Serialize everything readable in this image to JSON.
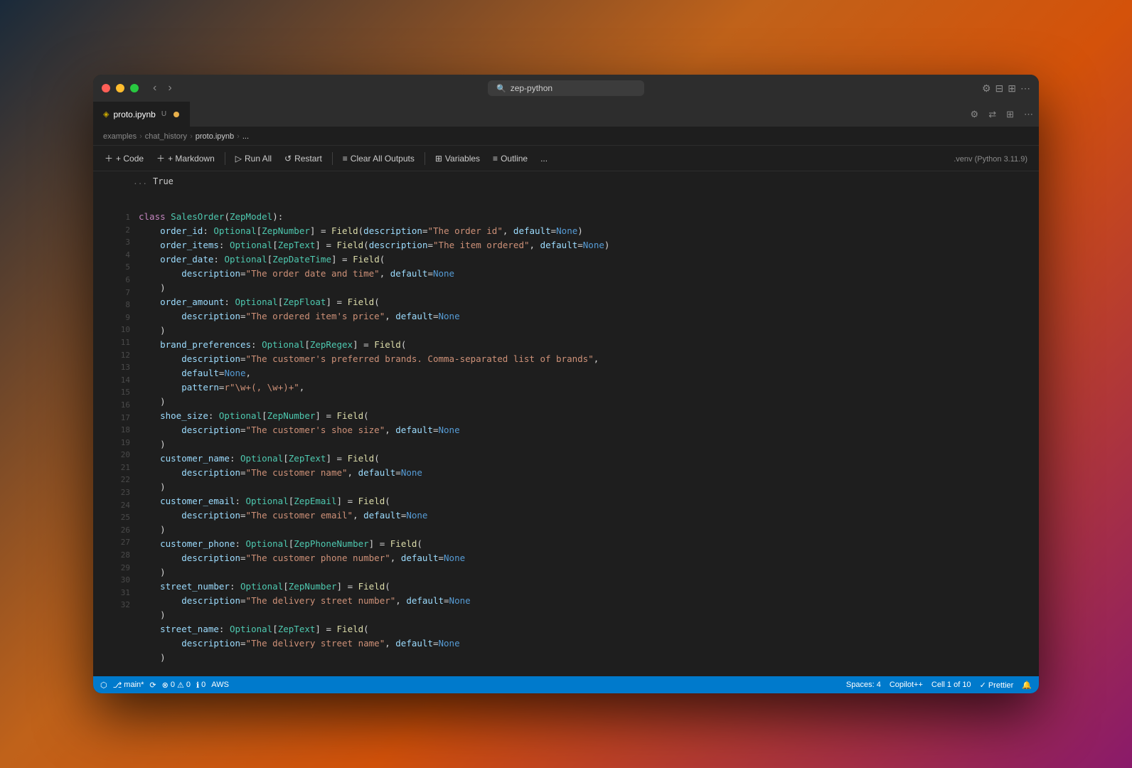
{
  "window": {
    "title": "zep-python"
  },
  "tab": {
    "name": "proto.ipynb",
    "badge": "U",
    "modified": true
  },
  "breadcrumb": {
    "items": [
      "examples",
      "chat_history",
      "proto.ipynb",
      "..."
    ]
  },
  "toolbar": {
    "code_label": "+ Code",
    "markdown_label": "+ Markdown",
    "run_all_label": "Run All",
    "restart_label": "Restart",
    "clear_outputs_label": "Clear All Outputs",
    "variables_label": "Variables",
    "outline_label": "Outline",
    "more_label": "..."
  },
  "output": {
    "prompt": "...",
    "text": "True"
  },
  "code": {
    "lines": [
      "class SalesOrder(ZepModel):",
      "    order_id: Optional[ZepNumber] = Field(description=\"The order id\", default=None)",
      "    order_items: Optional[ZepText] = Field(description=\"The item ordered\", default=None)",
      "    order_date: Optional[ZepDateTime] = Field(",
      "        description=\"The order date and time\", default=None",
      "    )",
      "    order_amount: Optional[ZepFloat] = Field(",
      "        description=\"The ordered item's price\", default=None",
      "    )",
      "    brand_preferences: Optional[ZepRegex] = Field(",
      "        description=\"The customer's preferred brands. Comma-separated list of brands\",",
      "        default=None,",
      "        pattern=r\"\\w+(, \\w+)+\",",
      "    )",
      "    shoe_size: Optional[ZepNumber] = Field(",
      "        description=\"The customer's shoe size\", default=None",
      "    )",
      "    customer_name: Optional[ZepText] = Field(",
      "        description=\"The customer name\", default=None",
      "    )",
      "    customer_email: Optional[ZepEmail] = Field(",
      "        description=\"The customer email\", default=None",
      "    )",
      "    customer_phone: Optional[ZepPhoneNumber] = Field(",
      "        description=\"The customer phone number\", default=None",
      "    )",
      "    street_number: Optional[ZepNumber] = Field(",
      "        description=\"The delivery street number\", default=None",
      "    )",
      "    street_name: Optional[ZepText] = Field(",
      "        description=\"The delivery street name\", default=None",
      "    )"
    ]
  },
  "status_bar": {
    "branch": "main*",
    "sync_icon": "⟳",
    "errors": "0",
    "warnings": "0",
    "info": "0",
    "spaces": "Spaces: 4",
    "copilot": "Copilot++",
    "cell": "Cell 1 of 10",
    "prettier": "✓ Prettier",
    "encoding": "",
    "python_env": ".venv (Python 3.11.9)",
    "aws": "AWS"
  }
}
